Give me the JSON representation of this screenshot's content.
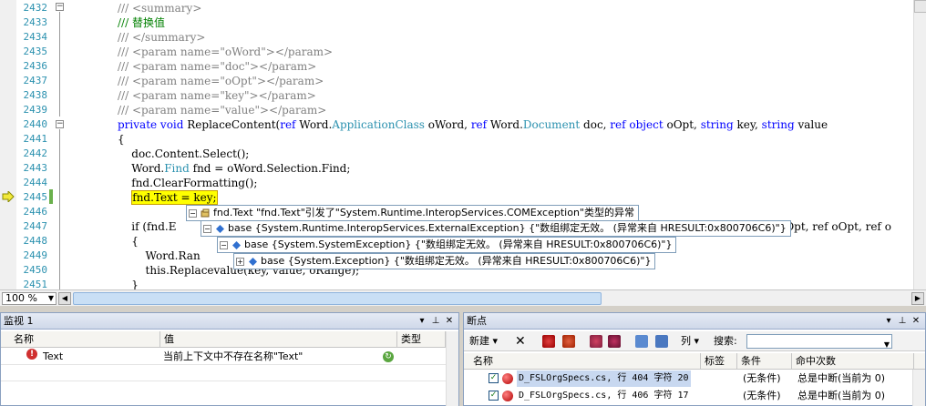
{
  "editor": {
    "lines": [
      {
        "num": "2432",
        "text": "/// <summary>",
        "cls": "c-gray"
      },
      {
        "num": "2433",
        "text": "/// 替换值",
        "cls": "c-green"
      },
      {
        "num": "2434",
        "text": "/// </summary>",
        "cls": "c-gray"
      },
      {
        "num": "2435",
        "text": "/// <param name=\"oWord\"></param>",
        "cls": "c-gray"
      },
      {
        "num": "2436",
        "text": "/// <param name=\"doc\"></param>",
        "cls": "c-gray"
      },
      {
        "num": "2437",
        "text": "/// <param name=\"oOpt\"></param>",
        "cls": "c-gray"
      },
      {
        "num": "2438",
        "text": "/// <param name=\"key\"></param>",
        "cls": "c-gray"
      },
      {
        "num": "2439",
        "text": "/// <param name=\"value\"></param>",
        "cls": "c-gray"
      },
      {
        "num": "2440",
        "text": "",
        "cls": ""
      },
      {
        "num": "2441",
        "text": "{",
        "cls": ""
      },
      {
        "num": "2442",
        "text": "    doc.Content.Select();",
        "cls": ""
      },
      {
        "num": "2443",
        "text": "",
        "cls": ""
      },
      {
        "num": "2444",
        "text": "    fnd.ClearFormatting();",
        "cls": ""
      },
      {
        "num": "2445",
        "text": "",
        "cls": ""
      },
      {
        "num": "2446",
        "text": "",
        "cls": ""
      },
      {
        "num": "2447",
        "text": "    if (fnd.E",
        "cls": ""
      },
      {
        "num": "2448",
        "text": "    {",
        "cls": ""
      },
      {
        "num": "2449",
        "text": "        Word.Ran",
        "cls": ""
      },
      {
        "num": "2450",
        "text": "        this.Replacevalue(key, value, oRange);",
        "cls": ""
      },
      {
        "num": "2451",
        "text": "    }",
        "cls": ""
      }
    ],
    "signature": {
      "kw1": "private void",
      "name": " ReplaceContent(",
      "ref1": "ref",
      "word1": " Word.",
      "type1": "ApplicationClass",
      "rest1": " oWord, ",
      "ref2": "ref",
      "word2": " Word.",
      "type2": "Document",
      "rest2": " doc, ",
      "ref3": "ref object",
      "rest3": " oOpt, ",
      "kw4": "string",
      "rest4": " key, ",
      "kw5": "string",
      "rest5": " value"
    },
    "line2443": {
      "a": "    Word.",
      "type": "Find",
      "b": " fnd = oWord.Selection.Find;"
    },
    "current_line": "fnd.Text = key;",
    "tail_2447": "' oOpt, ref oOpt, ref o"
  },
  "zoom": "100 %",
  "tooltips": {
    "t1_name": "fnd.Text",
    "t1_msg": "\"fnd.Text\"引发了\"System.Runtime.InteropServices.COMException\"类型的异常",
    "t2": "base {System.Runtime.InteropServices.ExternalException} {\"数组绑定无效。 (异常来自 HRESULT:0x800706C6)\"}",
    "t3": "base {System.SystemException} {\"数组绑定无效。 (异常来自 HRESULT:0x800706C6)\"}",
    "t4": "base {System.Exception} {\"数组绑定无效。 (异常来自 HRESULT:0x800706C6)\"}"
  },
  "watch": {
    "title": "监视 1",
    "col_name": "名称",
    "col_value": "值",
    "col_type": "类型",
    "rows": [
      {
        "name": "Text",
        "value": "当前上下文中不存在名称\"Text\""
      }
    ]
  },
  "breakpoints": {
    "title": "断点",
    "new_label": "新建",
    "columns_label": "列",
    "search_label": "搜索:",
    "col_name": "名称",
    "col_tag": "标签",
    "col_cond": "条件",
    "col_hits": "命中次数",
    "rows": [
      {
        "name": "D_FSLOrgSpecs.cs, 行 404 字符 20",
        "cond": "(无条件)",
        "hits": "总是中断(当前为 0)"
      },
      {
        "name": "D_FSLOrgSpecs.cs, 行 406 字符 17",
        "cond": "(无条件)",
        "hits": "总是中断(当前为 0)"
      }
    ]
  },
  "colors": {
    "accent": "#1c5180",
    "highlight": "#ffff00",
    "error": "#d03030"
  },
  "icons": [
    "breakpoint-arrow-icon",
    "collapse-icon",
    "error-icon",
    "refresh-icon",
    "breakpoint-dot-icon",
    "delete-icon",
    "close-icon",
    "pin-icon",
    "dropdown-icon"
  ]
}
